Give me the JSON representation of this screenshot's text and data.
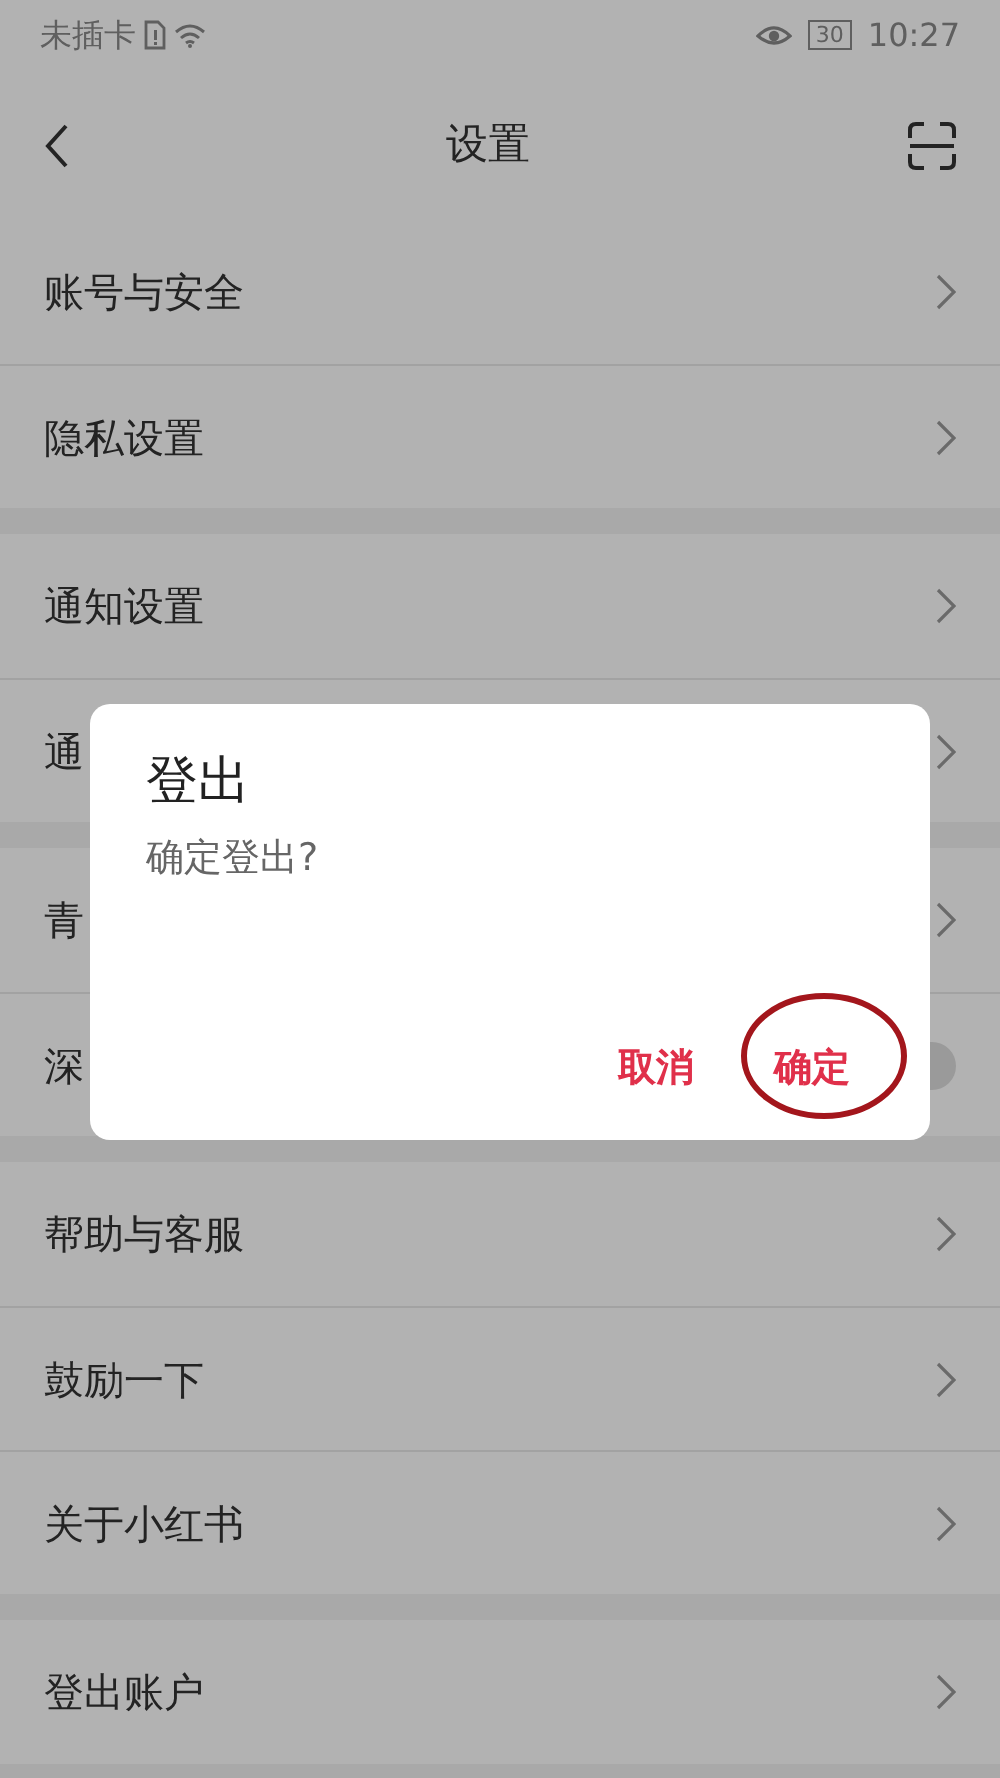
{
  "status_bar": {
    "carrier": "未插卡",
    "battery": "30",
    "time": "10:27"
  },
  "header": {
    "title": "设置"
  },
  "sections": [
    {
      "items": [
        {
          "label": "账号与安全",
          "kind": "link"
        },
        {
          "label": "隐私设置",
          "kind": "link"
        }
      ]
    },
    {
      "items": [
        {
          "label": "通知设置",
          "kind": "link"
        },
        {
          "label": "通",
          "kind": "link"
        }
      ]
    },
    {
      "items": [
        {
          "label": "青",
          "kind": "link"
        },
        {
          "label": "深",
          "kind": "toggle",
          "on": false
        }
      ]
    },
    {
      "items": [
        {
          "label": "帮助与客服",
          "kind": "link"
        },
        {
          "label": "鼓励一下",
          "kind": "link"
        },
        {
          "label": "关于小红书",
          "kind": "link"
        }
      ]
    },
    {
      "items": [
        {
          "label": "登出账户",
          "kind": "link"
        }
      ]
    }
  ],
  "dialog": {
    "title": "登出",
    "message": "确定登出?",
    "buttons": [
      {
        "label": "取消",
        "circled": false
      },
      {
        "label": "确定",
        "circled": true
      }
    ]
  }
}
